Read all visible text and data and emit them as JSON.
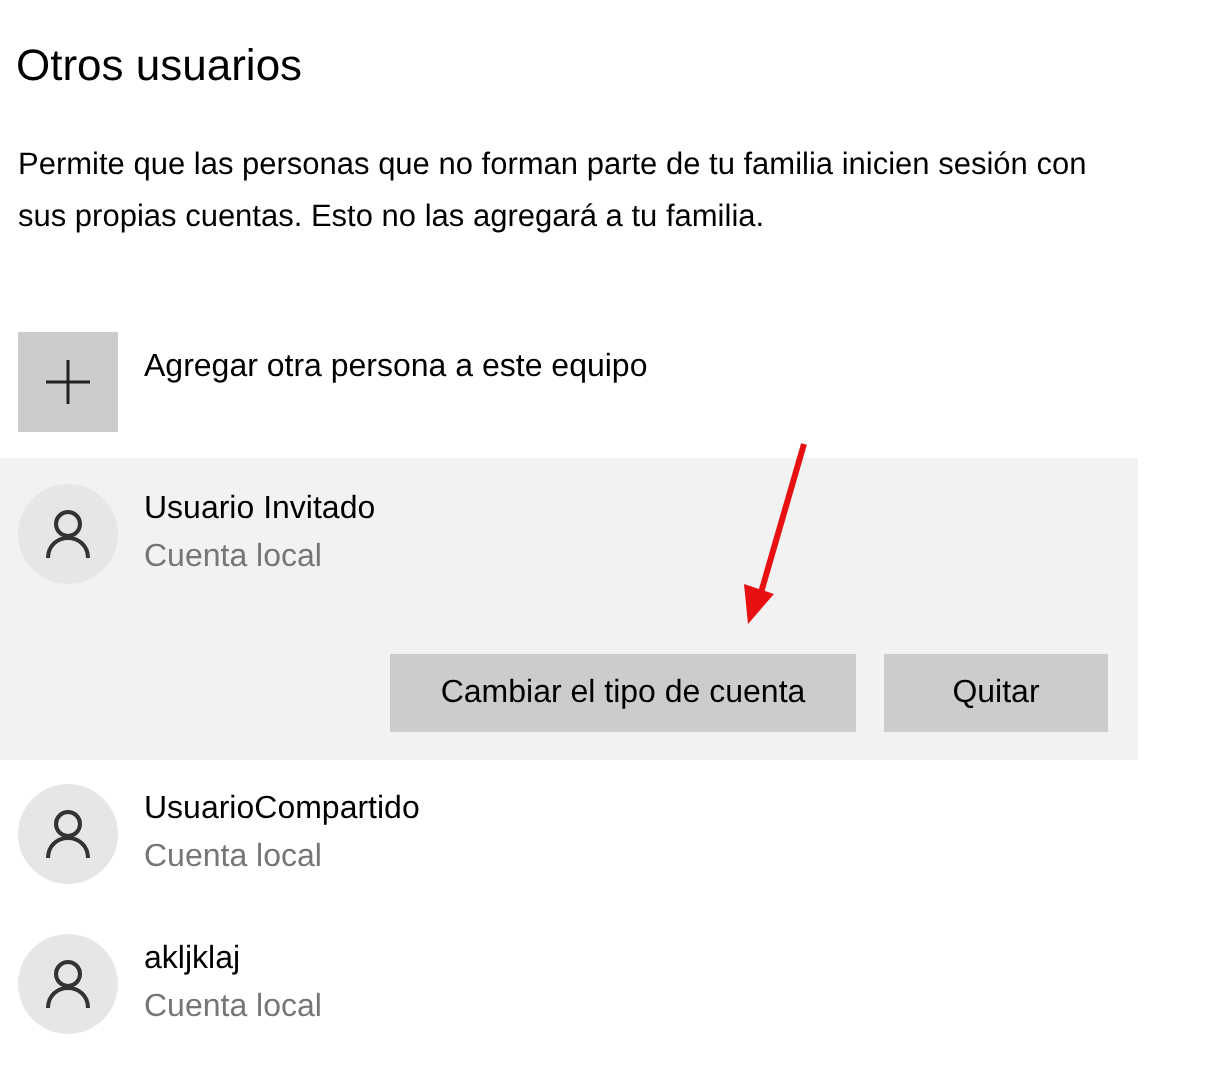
{
  "title": "Otros usuarios",
  "description": "Permite que las personas que no forman parte de tu familia inicien sesión con sus propias cuentas. Esto no las agregará a tu familia.",
  "add_button": {
    "label": "Agregar otra persona a este equipo"
  },
  "users": [
    {
      "name": "Usuario Invitado",
      "subtitle": "Cuenta local",
      "selected": true,
      "actions": [
        "Cambiar el tipo de cuenta",
        "Quitar"
      ]
    },
    {
      "name": "UsuarioCompartido",
      "subtitle": "Cuenta local",
      "selected": false
    },
    {
      "name": "akljklaj",
      "subtitle": "Cuenta local",
      "selected": false
    }
  ]
}
